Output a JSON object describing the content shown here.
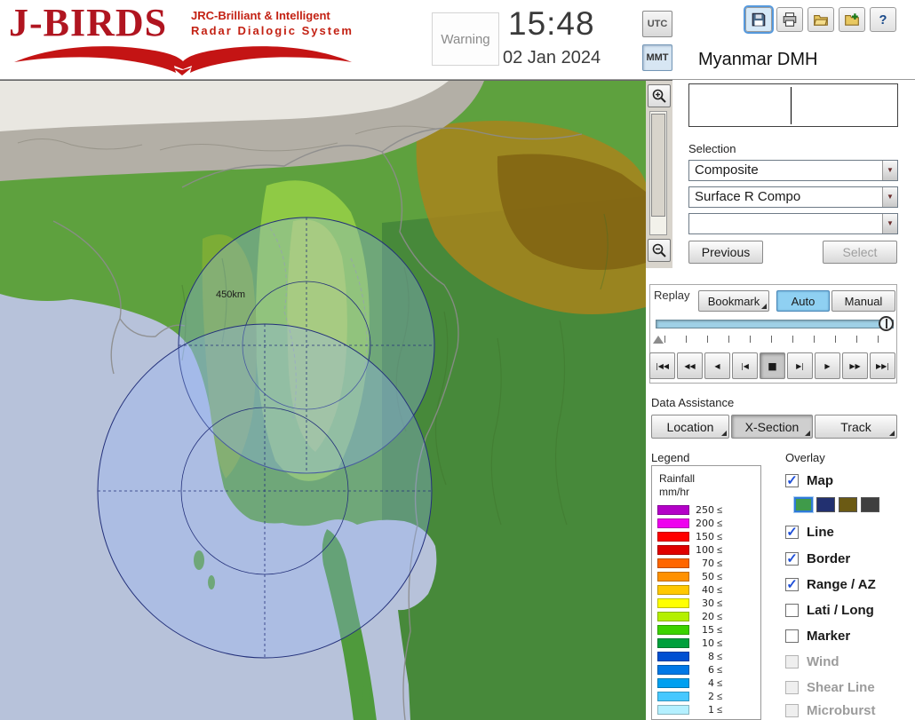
{
  "header": {
    "logo": {
      "title": "J-BIRDS",
      "tagline1": "JRC-Brilliant & Intelligent",
      "tagline2": "Radar  Dialogic  System"
    },
    "warning_label": "Warning",
    "clock": {
      "time": "15:48",
      "date": "02 Jan 2024"
    },
    "tz": {
      "utc": "UTC",
      "mmt": "MMT",
      "selected": "MMT"
    },
    "toolbar": [
      "save",
      "print",
      "open",
      "export",
      "help"
    ],
    "org_name": "Myanmar DMH"
  },
  "map": {
    "range_label": "450km"
  },
  "panel": {
    "selection": {
      "label": "Selection",
      "dropdowns": [
        {
          "value": "Composite"
        },
        {
          "value": "Surface R Compo"
        },
        {
          "value": ""
        }
      ],
      "previous_label": "Previous",
      "select_label": "Select"
    },
    "replay": {
      "label": "Replay",
      "bookmark_label": "Bookmark",
      "auto_label": "Auto",
      "manual_label": "Manual",
      "active_mode": "Auto",
      "transport": [
        "|◀◀",
        "◀◀",
        "◀",
        "|◀",
        "■",
        "▶|",
        "▶",
        "▶▶",
        "▶▶|"
      ]
    },
    "data_assistance": {
      "label": "Data Assistance",
      "location_label": "Location",
      "xsection_label": "X-Section",
      "track_label": "Track",
      "pressed": "X-Section"
    },
    "legend": {
      "label": "Legend",
      "unit_line1": "Rainfall",
      "unit_line2": "mm/hr",
      "suffix": "≤",
      "entries": [
        {
          "value": "250",
          "color": "#b400c8"
        },
        {
          "value": "200",
          "color": "#ee00ee"
        },
        {
          "value": "150",
          "color": "#ff0000"
        },
        {
          "value": "100",
          "color": "#e00000"
        },
        {
          "value": "70",
          "color": "#ff6600"
        },
        {
          "value": "50",
          "color": "#ff9100"
        },
        {
          "value": "40",
          "color": "#ffc800"
        },
        {
          "value": "30",
          "color": "#ffff00"
        },
        {
          "value": "20",
          "color": "#b4f000"
        },
        {
          "value": "15",
          "color": "#3cd200"
        },
        {
          "value": "10",
          "color": "#00a03c"
        },
        {
          "value": "8",
          "color": "#0050d2"
        },
        {
          "value": "6",
          "color": "#0078e6"
        },
        {
          "value": "4",
          "color": "#00a0f0"
        },
        {
          "value": "2",
          "color": "#46c8ff"
        },
        {
          "value": "1",
          "color": "#b4f0ff"
        }
      ]
    },
    "overlay": {
      "label": "Overlay",
      "items": [
        {
          "label": "Map",
          "checked": true,
          "enabled": true
        },
        {
          "label": "Line",
          "checked": true,
          "enabled": true
        },
        {
          "label": "Border",
          "checked": true,
          "enabled": true
        },
        {
          "label": "Range / AZ",
          "checked": true,
          "enabled": true
        },
        {
          "label": "Lati / Long",
          "checked": false,
          "enabled": true
        },
        {
          "label": "Marker",
          "checked": false,
          "enabled": true
        },
        {
          "label": "Wind",
          "checked": false,
          "enabled": false
        },
        {
          "label": "Shear Line",
          "checked": false,
          "enabled": false
        },
        {
          "label": "Microburst",
          "checked": false,
          "enabled": false
        }
      ],
      "map_swatches": [
        {
          "color": "#3f9b4a",
          "selected": true
        },
        {
          "color": "#223070",
          "selected": false
        },
        {
          "color": "#6b5a14",
          "selected": false
        },
        {
          "color": "#3f3f3f",
          "selected": false
        }
      ]
    }
  },
  "colors": {
    "auto_button_active": "#8fd0f2",
    "radar_ring_stroke": "#23307a",
    "sea": "#b7c2da"
  }
}
